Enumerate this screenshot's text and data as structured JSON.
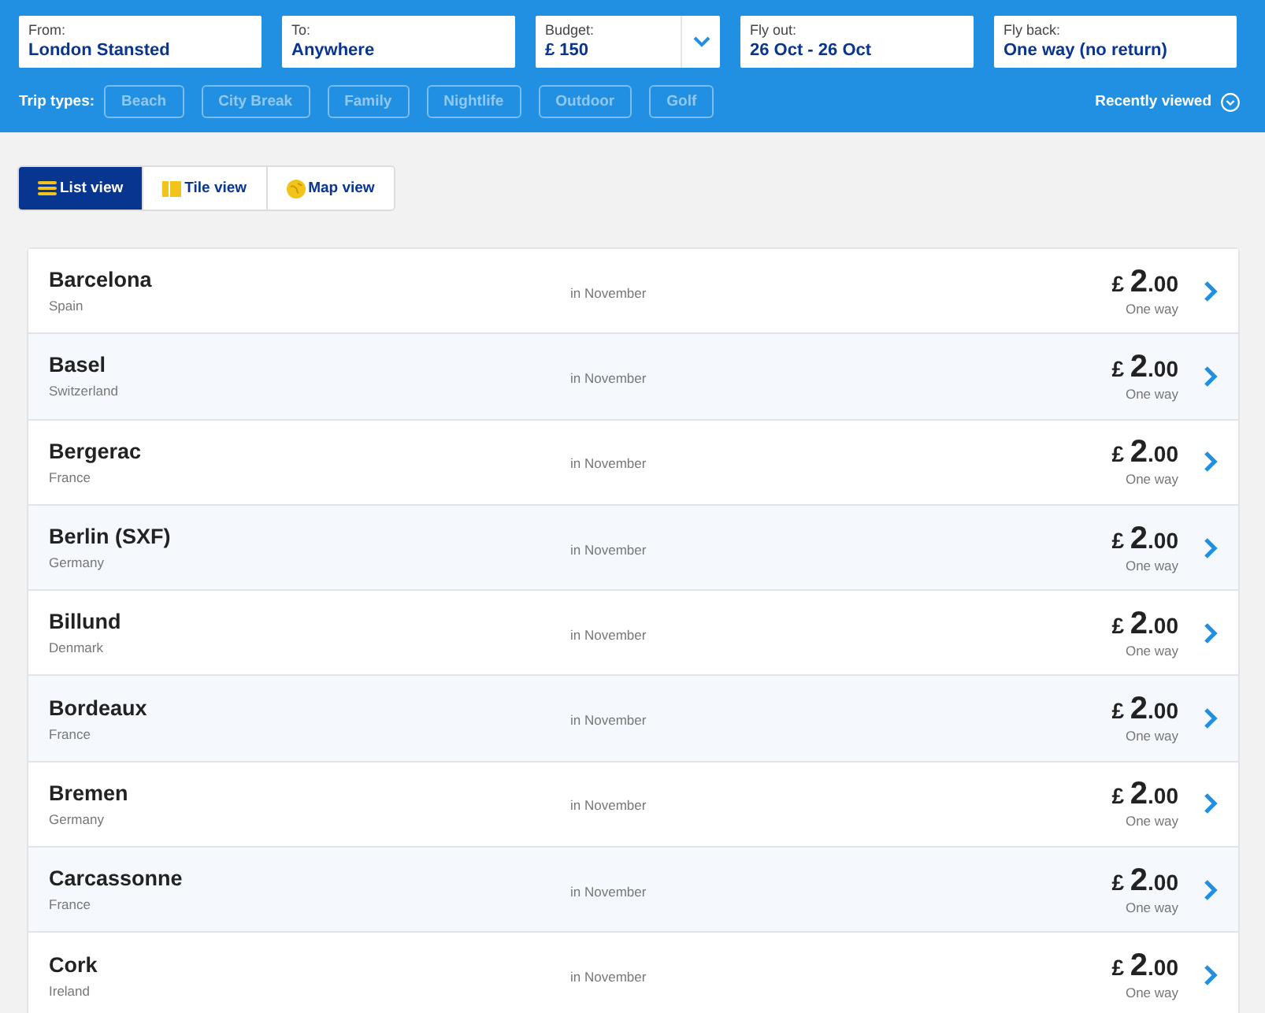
{
  "search": {
    "fields": [
      {
        "kind": "text",
        "label": "From:",
        "value": "London Stansted"
      },
      {
        "kind": "text",
        "label": "To:",
        "value": "Anywhere"
      },
      {
        "kind": "dropdown",
        "label": "Budget:",
        "value": "£ 150"
      },
      {
        "kind": "text",
        "label": "Fly out:",
        "value": "26 Oct - 26 Oct"
      },
      {
        "kind": "text",
        "label": "Fly back:",
        "value": "One way (no return)"
      }
    ],
    "trip_types": {
      "label": "Trip types:",
      "options": [
        {
          "label": "Beach",
          "selected": false
        },
        {
          "label": "City Break",
          "selected": false
        },
        {
          "label": "Family",
          "selected": false
        },
        {
          "label": "Nightlife",
          "selected": false
        },
        {
          "label": "Outdoor",
          "selected": false
        },
        {
          "label": "Golf",
          "selected": false
        }
      ]
    },
    "recently_viewed": {
      "label": "Recently viewed"
    }
  },
  "view_tabs": [
    {
      "kind": "list",
      "label": "List view",
      "selected": true
    },
    {
      "kind": "tile",
      "label": "Tile view",
      "selected": false
    },
    {
      "kind": "map",
      "label": "Map view",
      "selected": false
    }
  ],
  "destinations": [
    {
      "city": "Barcelona",
      "country": "Spain",
      "period": "in November",
      "price": "£ 2.00",
      "fare_type": "One way"
    },
    {
      "city": "Basel",
      "country": "Switzerland",
      "period": "in November",
      "price": "£ 2.00",
      "fare_type": "One way"
    },
    {
      "city": "Bergerac",
      "country": "France",
      "period": "in November",
      "price": "£ 2.00",
      "fare_type": "One way"
    },
    {
      "city": "Berlin (SXF)",
      "country": "Germany",
      "period": "in November",
      "price": "£ 2.00",
      "fare_type": "One way"
    },
    {
      "city": "Billund",
      "country": "Denmark",
      "period": "in November",
      "price": "£ 2.00",
      "fare_type": "One way"
    },
    {
      "city": "Bordeaux",
      "country": "France",
      "period": "in November",
      "price": "£ 2.00",
      "fare_type": "One way"
    },
    {
      "city": "Bremen",
      "country": "Germany",
      "period": "in November",
      "price": "£ 2.00",
      "fare_type": "One way"
    },
    {
      "city": "Carcassonne",
      "country": "France",
      "period": "in November",
      "price": "£ 2.00",
      "fare_type": "One way"
    },
    {
      "city": "Cork",
      "country": "Ireland",
      "period": "in November",
      "price": "£ 2.00",
      "fare_type": "One way"
    }
  ]
}
